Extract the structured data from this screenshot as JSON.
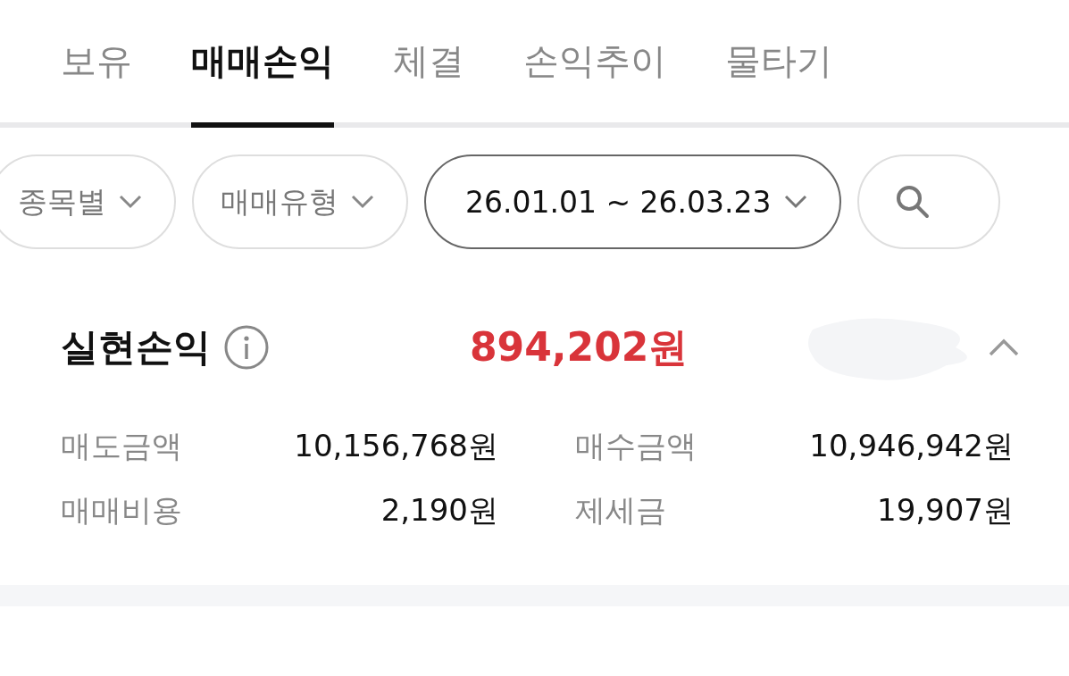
{
  "tabs": [
    {
      "label": "보유",
      "selected": false
    },
    {
      "label": "매매손익",
      "selected": true
    },
    {
      "label": "체결",
      "selected": false
    },
    {
      "label": "손익추이",
      "selected": false
    },
    {
      "label": "물타기",
      "selected": false
    }
  ],
  "filters": [
    {
      "kind": "dropdown",
      "label": "종목별",
      "selected": false
    },
    {
      "kind": "dropdown",
      "label": "매매유형",
      "selected": false
    },
    {
      "kind": "dropdown",
      "label": "26.01.01 ~ 26.03.23",
      "selected": true
    },
    {
      "kind": "search",
      "selected": false
    }
  ],
  "summary": {
    "title": "실현손익",
    "amount": "894,202원",
    "expanded": true,
    "details": [
      {
        "label": "매도금액",
        "value": "10,156,768원"
      },
      {
        "label": "매수금액",
        "value": "10,946,942원"
      },
      {
        "label": "매매비용",
        "value": "2,190원"
      },
      {
        "label": "제세금",
        "value": "19,907원"
      }
    ]
  }
}
